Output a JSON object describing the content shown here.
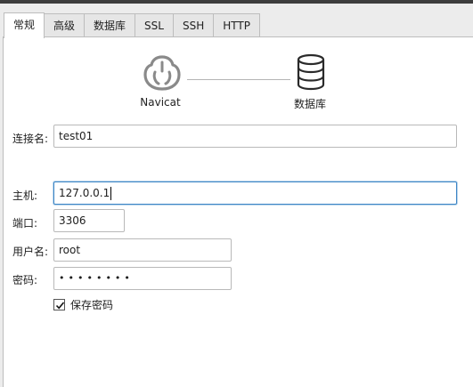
{
  "tabs": [
    {
      "label": "常规",
      "active": true
    },
    {
      "label": "高级",
      "active": false
    },
    {
      "label": "数据库",
      "active": false
    },
    {
      "label": "SSL",
      "active": false
    },
    {
      "label": "SSH",
      "active": false
    },
    {
      "label": "HTTP",
      "active": false
    }
  ],
  "diagram": {
    "client_label": "Navicat",
    "server_label": "数据库",
    "client_icon": "navicat-logo-icon",
    "server_icon": "database-icon"
  },
  "form": {
    "connection_name": {
      "label": "连接名:",
      "value": "test01"
    },
    "host": {
      "label": "主机:",
      "value": "127.0.0.1"
    },
    "port": {
      "label": "端口:",
      "value": "3306"
    },
    "username": {
      "label": "用户名:",
      "value": "root"
    },
    "password": {
      "label": "密码:",
      "value": "••••••••"
    },
    "save_password": {
      "label": "保存密码",
      "checked": true
    }
  },
  "colors": {
    "focus_border": "#3d86c6",
    "panel_bg": "#ffffff",
    "window_bg": "#ececec"
  }
}
